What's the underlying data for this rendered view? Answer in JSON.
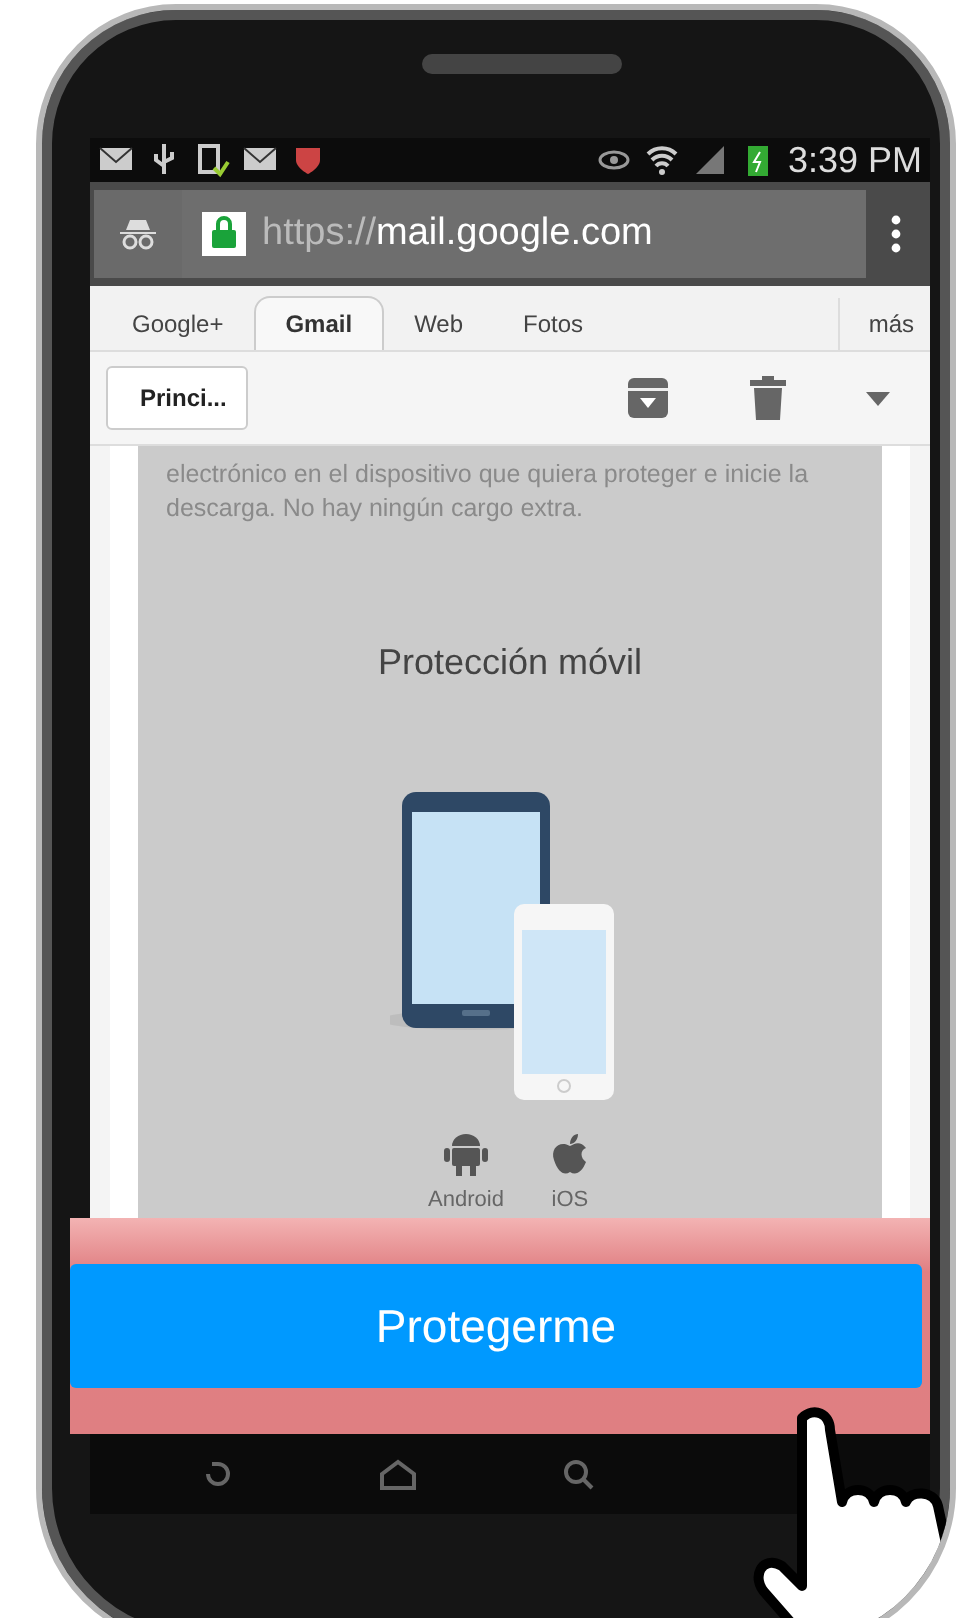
{
  "status_bar": {
    "time": "3:39 PM"
  },
  "address_bar": {
    "scheme": "https://",
    "host": "mail.google.com"
  },
  "tabs": [
    {
      "label": "Google+",
      "selected": false
    },
    {
      "label": "Gmail",
      "selected": true
    },
    {
      "label": "Web",
      "selected": false
    },
    {
      "label": "Fotos",
      "selected": false
    },
    {
      "label": "más",
      "selected": false
    }
  ],
  "toolbar": {
    "back_label": "Princi..."
  },
  "message": {
    "paragraph": "electrónico en el dispositivo que quiera proteger e inicie la descarga. No hay ningún cargo extra.",
    "heading": "Protección móvil",
    "platforms": [
      {
        "kind": "android",
        "label": "Android"
      },
      {
        "kind": "ios",
        "label": "iOS"
      }
    ]
  },
  "action_button": {
    "label": "Protegerme"
  }
}
